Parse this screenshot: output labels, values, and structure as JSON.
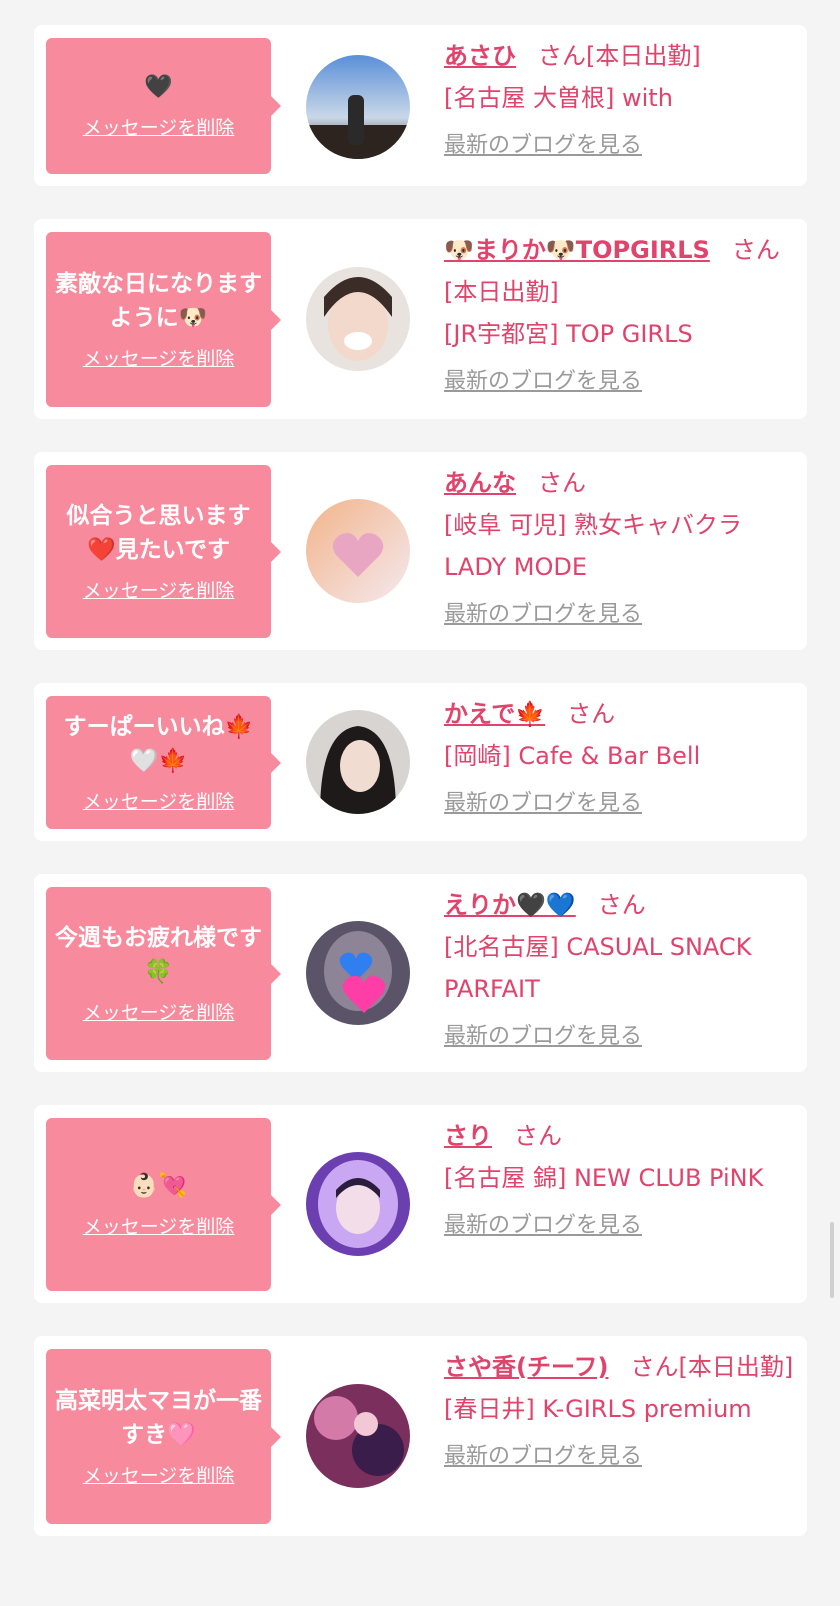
{
  "delete_label": "メッセージを削除",
  "blog_label": "最新のブログを見る",
  "san_label": "さん",
  "cards": [
    {
      "message": "🖤",
      "name": "あさひ",
      "suffix": "[本日出勤]",
      "shop": "[名古屋 大曽根] with"
    },
    {
      "message": "素敵な日になりますように🐶",
      "name": "🐶まりか🐶TOPGIRLS",
      "suffix": "[本日出勤]",
      "shop": "[JR宇都宮] TOP GIRLS"
    },
    {
      "message": "似合うと思います❤️見たいです",
      "name": "あんな",
      "suffix": "",
      "shop": "[岐阜 可児] 熟女キャバクラ LADY MODE"
    },
    {
      "message": "すーぱーいいね🍁🤍🍁",
      "name": "かえで🍁",
      "suffix": "",
      "shop": "[岡崎] Cafe & Bar Bell"
    },
    {
      "message": "今週もお疲れ様です🍀",
      "name": "えりか🖤💙",
      "suffix": "",
      "shop": "[北名古屋] CASUAL SNACK PARFAIT"
    },
    {
      "message": "👶🏻💘",
      "name": "さり",
      "suffix": "",
      "shop": "[名古屋 錦] NEW CLUB PiNK"
    },
    {
      "message": "高菜明太マヨが一番すき🩷",
      "name": "さや香(チーフ)",
      "suffix": "[本日出勤]",
      "shop": "[春日井] K-GIRLS premium"
    }
  ],
  "colors": {
    "page_bg": "#f4f4f4",
    "bubble": "#f78a9c",
    "accent": "#e0436b",
    "blog_link": "#9a9a9a"
  }
}
